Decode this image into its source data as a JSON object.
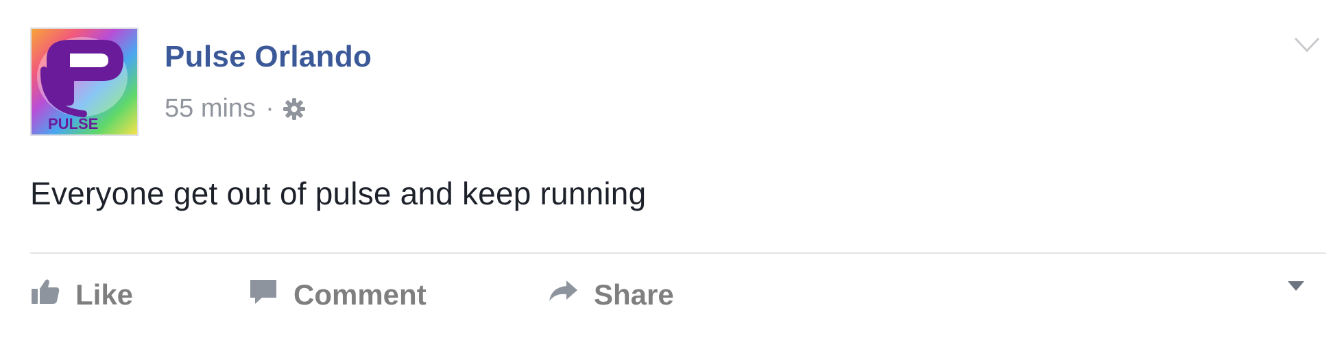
{
  "post": {
    "page_name": "Pulse Orlando",
    "timestamp": "55 mins",
    "separator": "·",
    "privacy_icon": "gear-icon",
    "message": "Everyone get out of pulse and keep running",
    "logo_text": "PULSE",
    "options_icon": "chevron-down-icon"
  },
  "actions": {
    "like_label": "Like",
    "comment_label": "Comment",
    "share_label": "Share",
    "like_icon": "thumbs-up-icon",
    "comment_icon": "speech-bubble-icon",
    "share_icon": "share-arrow-icon",
    "more_icon": "caret-down-icon"
  },
  "colors": {
    "page_name": "#3b5998",
    "meta": "#90949c",
    "message": "#1d2129",
    "action": "#7f7f7f",
    "divider": "#e5e5e5",
    "logo_purple": "#6a1b9a"
  }
}
